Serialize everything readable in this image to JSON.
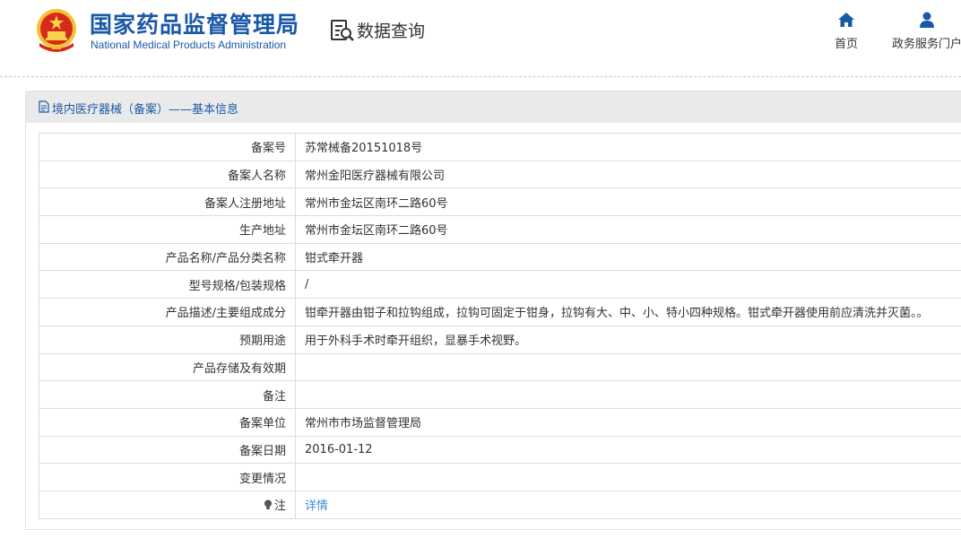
{
  "header": {
    "logo_cn": "国家药品监督管理局",
    "logo_en": "National Medical Products Administration",
    "query_title": "数据查询",
    "nav": [
      {
        "label": "首页",
        "icon": "home-icon"
      },
      {
        "label": "政务服务门户",
        "icon": "user-icon"
      }
    ]
  },
  "panel": {
    "title": "境内医疗器械（备案）——基本信息",
    "rows": [
      {
        "label": "备案号",
        "value": "苏常械备20151018号"
      },
      {
        "label": "备案人名称",
        "value": "常州金阳医疗器械有限公司"
      },
      {
        "label": "备案人注册地址",
        "value": "常州市金坛区南环二路60号"
      },
      {
        "label": "生产地址",
        "value": "常州市金坛区南环二路60号"
      },
      {
        "label": "产品名称/产品分类名称",
        "value": "钳式牵开器"
      },
      {
        "label": "型号规格/包装规格",
        "value": "/"
      },
      {
        "label": "产品描述/主要组成成分",
        "value": "钳牵开器由钳子和拉钩组成，拉钩可固定于钳身，拉钩有大、中、小、特小四种规格。钳式牵开器使用前应清洗并灭菌。。"
      },
      {
        "label": "预期用途",
        "value": "用于外科手术时牵开组织，显暴手术视野。"
      },
      {
        "label": "产品存储及有效期",
        "value": ""
      },
      {
        "label": "备注",
        "value": ""
      },
      {
        "label": "备案单位",
        "value": "常州市市场监督管理局"
      },
      {
        "label": "备案日期",
        "value": "2016-01-12"
      },
      {
        "label": "变更情况",
        "value": ""
      }
    ],
    "note_row": {
      "label": "注",
      "link": "详情"
    }
  },
  "colors": {
    "brand_blue": "#1a58a8",
    "link_blue": "#3c8dd8",
    "panel_head_bg": "#eaeaea"
  }
}
